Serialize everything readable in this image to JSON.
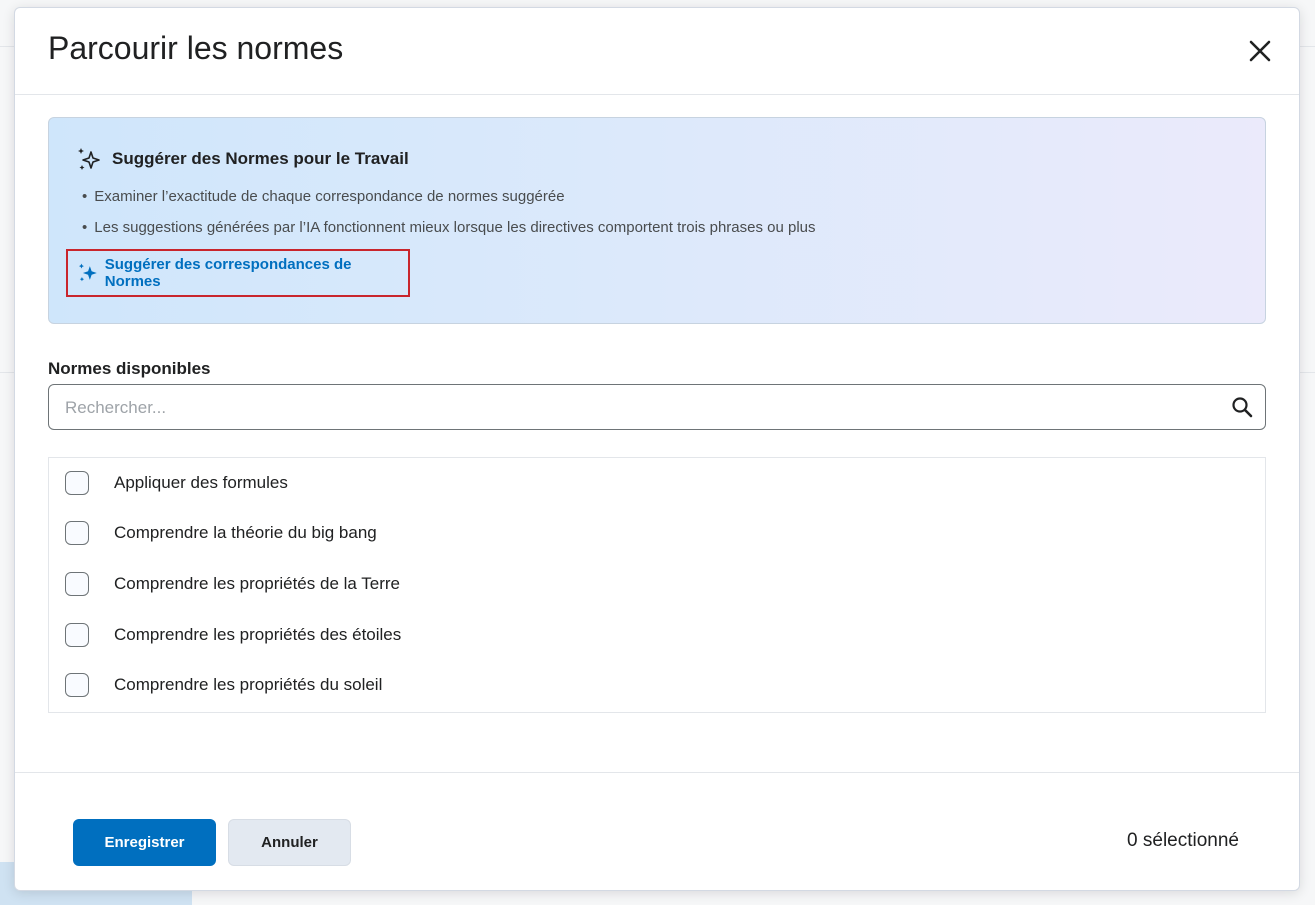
{
  "dialog": {
    "title": "Parcourir les normes",
    "close_icon": "close-icon"
  },
  "ai_panel": {
    "heading_icon": "sparkles-outline-icon",
    "heading": "Suggérer des Normes pour le Travail",
    "bullets": [
      "Examiner l’exactitude de chaque correspondance de normes suggérée",
      "Les suggestions générées par l’IA fonctionnent mieux lorsque les directives comportent trois phrases ou plus"
    ],
    "suggest_icon": "sparkles-filled-icon",
    "suggest_label": "Suggérer des correspondances de Normes",
    "highlight_color": "#c9252c"
  },
  "available": {
    "label": "Normes disponibles",
    "search_placeholder": "Rechercher...",
    "search_value": "",
    "search_icon": "search-icon",
    "items": [
      {
        "label": "Appliquer des formules",
        "checked": false
      },
      {
        "label": "Comprendre la théorie du big bang",
        "checked": false
      },
      {
        "label": "Comprendre les propriétés de la Terre",
        "checked": false
      },
      {
        "label": "Comprendre les propriétés des étoiles",
        "checked": false
      },
      {
        "label": "Comprendre les propriétés du soleil",
        "checked": false
      }
    ]
  },
  "footer": {
    "save_label": "Enregistrer",
    "cancel_label": "Annuler",
    "selected_count": "0 sélectionné"
  },
  "colors": {
    "primary": "#006fbf",
    "link": "#006fbf"
  }
}
